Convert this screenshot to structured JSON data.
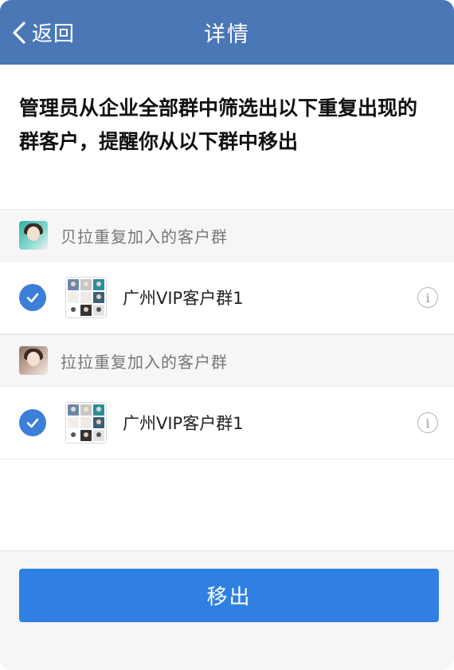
{
  "header": {
    "back_label": "返回",
    "title": "详情",
    "background": "#4a78b6"
  },
  "notice": {
    "text": "管理员从企业全部群中筛选出以下重复出现的群客户，提醒你从以下群中移出"
  },
  "sections": [
    {
      "title": "贝拉重复加入的客户群",
      "avatar_icon": "user-avatar",
      "groups": [
        {
          "name": "广州VIP客户群1",
          "checked": true,
          "info_icon": "info-icon"
        }
      ]
    },
    {
      "title": "拉拉重复加入的客户群",
      "avatar_icon": "user-avatar",
      "groups": [
        {
          "name": "广州VIP客户群1",
          "checked": true,
          "info_icon": "info-icon"
        }
      ]
    }
  ],
  "footer": {
    "remove_label": "移出",
    "button_color": "#2f80e2"
  },
  "colors": {
    "check": "#3d7fd8",
    "section_bg": "#f6f6f6"
  }
}
